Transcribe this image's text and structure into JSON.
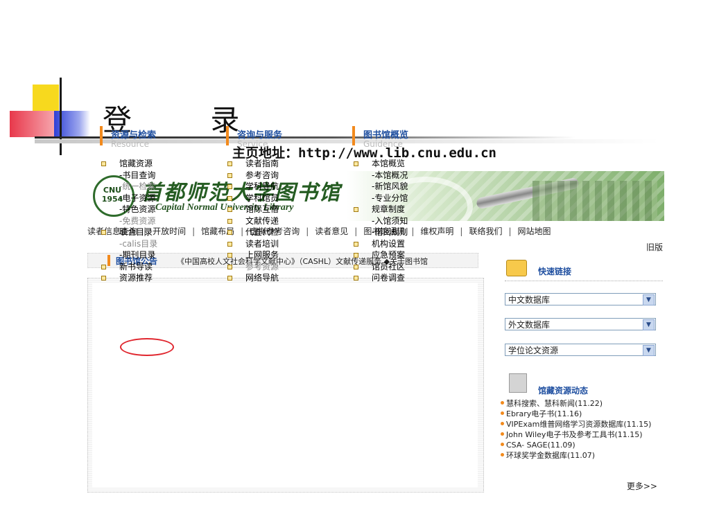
{
  "slide": {
    "title": "登 录",
    "subtitle": "主页地址：http://www.lib.cnu.edu.cn"
  },
  "site": {
    "logo_seal": "CNU 1954",
    "logo_cn": "首都师范大学图书馆",
    "logo_en": "Capital Normal University Library",
    "nav": [
      "读者信息查询",
      "开放时间",
      "馆藏布局",
      "虚拟参考咨询",
      "读者意见",
      "图书馆通讯",
      "维权声明",
      "联络我们",
      "网站地图"
    ],
    "old_version": "旧版",
    "notice": {
      "label": "图书馆公告",
      "text": "《中国高校人文社会科学文献中心》（CASHL）文献传递服务 ◆关于图书馆"
    },
    "columns": [
      {
        "title": "资源与检索",
        "subtitle": "Resource",
        "items": [
          {
            "text": "馆藏资源",
            "bullet": true
          },
          {
            "text": "-书目查询",
            "bullet": false
          },
          {
            "text": "-统一检索",
            "bullet": false
          },
          {
            "text": "-电子资源",
            "bullet": false
          },
          {
            "text": "-特色资源",
            "bullet": false
          },
          {
            "text": "-免费资源",
            "bullet": false
          },
          {
            "text": "联合目录",
            "bullet": true
          },
          {
            "text": "-calis目录",
            "bullet": false
          },
          {
            "text": "-期刊目录",
            "bullet": false
          },
          {
            "text": "新书导读",
            "bullet": true
          },
          {
            "text": "资源推荐",
            "bullet": true
          }
        ]
      },
      {
        "title": "咨询与服务",
        "subtitle": "Service",
        "items": [
          {
            "text": "读者指南",
            "bullet": true
          },
          {
            "text": "参考咨询",
            "bullet": true
          },
          {
            "text": "学科导航",
            "bullet": true
          },
          {
            "text": "学科馆员",
            "bullet": true
          },
          {
            "text": "馆际互借",
            "bullet": true
          },
          {
            "text": "文献传递",
            "bullet": true
          },
          {
            "text": "代查代检",
            "bullet": true
          },
          {
            "text": "读者培训",
            "bullet": true
          },
          {
            "text": "上网服务",
            "bullet": true
          },
          {
            "text": "参考资源",
            "bullet": true
          },
          {
            "text": "网络导航",
            "bullet": true
          }
        ]
      },
      {
        "title": "图书馆概览",
        "subtitle": "Guidence",
        "items": [
          {
            "text": "本馆概览",
            "bullet": true
          },
          {
            "text": "-本馆概况",
            "bullet": false
          },
          {
            "text": "-新馆风貌",
            "bullet": false
          },
          {
            "text": "-专业分馆",
            "bullet": false
          },
          {
            "text": "规章制度",
            "bullet": true
          },
          {
            "text": "-入馆须知",
            "bullet": false
          },
          {
            "text": "-借阅规则",
            "bullet": false
          },
          {
            "text": "机构设置",
            "bullet": true
          },
          {
            "text": "应急预案",
            "bullet": true
          },
          {
            "text": "馆员社区",
            "bullet": true
          },
          {
            "text": "问卷调查",
            "bullet": true
          }
        ]
      }
    ],
    "quick_links": {
      "title": "快速链接",
      "selects": [
        "中文数据库",
        "外文数据库",
        "学位论文资源"
      ]
    },
    "dynamics": {
      "title": "馆藏资源动态",
      "news": [
        "慧科搜索、慧科新闻(11.22)",
        "Ebrary电子书(11.16)",
        "VIPExam维普网络学习资源数据库(11.15)",
        "John Wiley电子书及参考工具书(11.15)",
        "CSA- SAGE(11.09)",
        "环球奖学金数据库(11.07)"
      ],
      "more": "更多>>"
    }
  }
}
